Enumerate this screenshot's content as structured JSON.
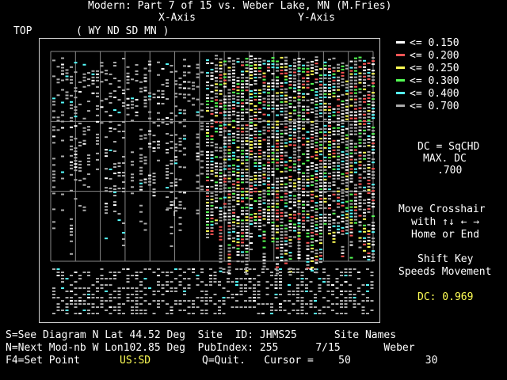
{
  "header": {
    "title": "Modern: Part 7 of 15 vs. Weber Lake, MN (M.Fries)",
    "x_axis_label": "X-Axis",
    "y_axis_label": "Y-Axis",
    "top_label": "TOP",
    "states": "( WY ND SD MN )"
  },
  "legend": [
    {
      "label": "<= 0.150",
      "color": "#ffffff"
    },
    {
      "label": "<= 0.200",
      "color": "#ff5555"
    },
    {
      "label": "<= 0.250",
      "color": "#ffff55"
    },
    {
      "label": "<= 0.300",
      "color": "#55ff55"
    },
    {
      "label": "<= 0.400",
      "color": "#55ffff"
    },
    {
      "label": "<= 0.700",
      "color": "#aaaaaa"
    }
  ],
  "info": {
    "dc_line": "DC = SqCHD",
    "max_dc_label": "MAX. DC",
    "max_dc_value": ".700",
    "move_1": "Move Crosshair",
    "move_2": "with ↑↓ ← →",
    "move_3": "Home or End",
    "shift_1": "Shift Key",
    "shift_2": "Speeds Movement",
    "dc_value_text": "DC: 0.969"
  },
  "footer": {
    "line1": "S=See Diagram N Lat 44.52 Deg  Site  ID: JHMS25      Site Names",
    "line2": "N=Next Mod-nb W Lon102.85 Deg  PubIndex: 255      7/15       Weber",
    "line3_a": "F4=Set Point",
    "line3_b": "US:SD",
    "line3_c": "Q=Quit.   Cursor =    50            30"
  }
}
